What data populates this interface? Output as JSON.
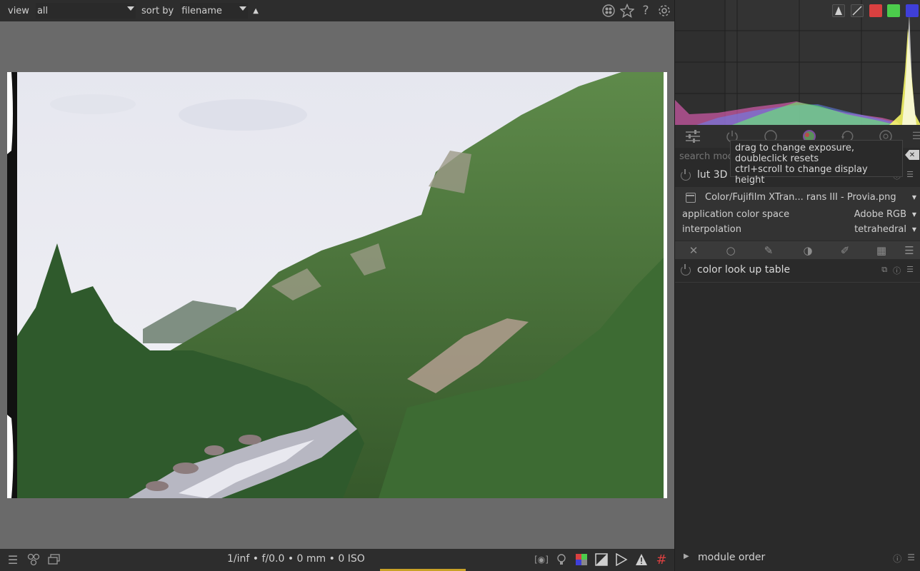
{
  "toolbar": {
    "view_label": "view",
    "view_value": "all",
    "sort_label": "sort by",
    "sort_value": "filename",
    "sort_dir_icon": "triangle-up-icon",
    "icons": [
      "color-labels-icon",
      "star-icon",
      "help-icon",
      "gear-icon"
    ]
  },
  "bottom": {
    "exif": "1/inf • f/0.0 • 0 mm • 0 ISO",
    "left_icons": [
      "menu-icon",
      "styles-icon",
      "display-icon"
    ],
    "right_icons": [
      "focus-peaking-icon",
      "bulb-icon",
      "color-assessment-icon",
      "raw-overexposed-icon",
      "clipping-icon",
      "warning-icon",
      "guides-icon"
    ]
  },
  "histogram": {
    "buttons": [
      "scope-type-icon",
      "scale-icon",
      "red-channel",
      "green-channel",
      "blue-channel"
    ],
    "colors": {
      "red": "#d94040",
      "green": "#4ccc4c",
      "blue": "#3f3fd9"
    }
  },
  "module_tabs": [
    "presets-icon",
    "power-icon",
    "circle-icon",
    "color-icon",
    "correct-icon",
    "effect-icon",
    "menu-icon"
  ],
  "search": {
    "placeholder": "search modules by name or tag"
  },
  "lut3d": {
    "title": "lut 3D",
    "file_value": "Color/Fujifilm XTran... rans III - Provia.png",
    "app_cs_label": "application color space",
    "app_cs_value": "Adobe RGB",
    "interp_label": "interpolation",
    "interp_value": "tetrahedral"
  },
  "masks_bar": [
    "off-icon",
    "uniform-icon",
    "drawn-icon",
    "parametric-icon",
    "drawn-parametric-icon",
    "raster-icon",
    "menu-icon"
  ],
  "color_lut": {
    "title": "color look up table"
  },
  "module_order": {
    "label": "module order"
  },
  "tooltip": {
    "line1": "drag to change exposure,",
    "line2": "doubleclick resets",
    "line3": "ctrl+scroll to change display height"
  }
}
